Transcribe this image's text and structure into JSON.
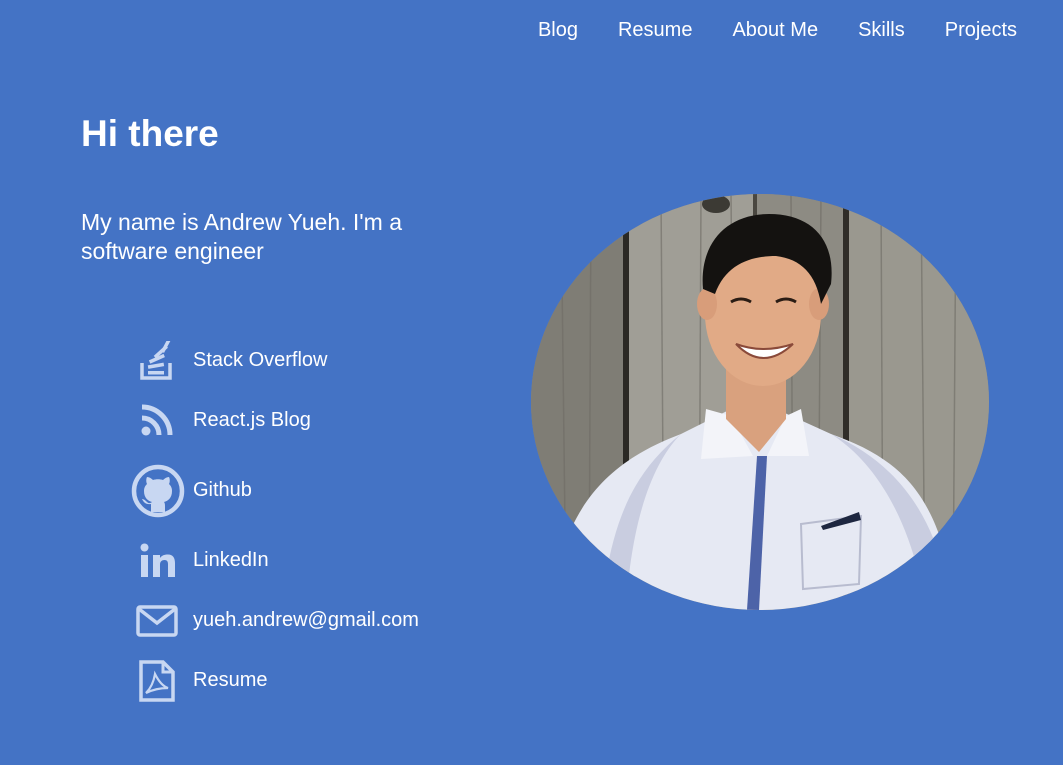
{
  "nav": {
    "items": [
      "Blog",
      "Resume",
      "About Me",
      "Skills",
      "Projects"
    ]
  },
  "hero": {
    "title": "Hi there",
    "subtitle": "My name is Andrew Yueh. I'm a software engineer"
  },
  "links": [
    {
      "label": "Stack Overflow",
      "icon": "stack-overflow-icon"
    },
    {
      "label": "React.js Blog",
      "icon": "rss-icon"
    },
    {
      "label": "Github",
      "icon": "github-icon"
    },
    {
      "label": "LinkedIn",
      "icon": "linkedin-icon"
    },
    {
      "label": "yueh.andrew@gmail.com",
      "icon": "mail-icon"
    },
    {
      "label": "Resume",
      "icon": "pdf-icon"
    }
  ],
  "colors": {
    "background": "#4473c5",
    "icon": "#c8d7f2",
    "text": "#ffffff"
  },
  "photo": {
    "subject": "profile-photo"
  }
}
